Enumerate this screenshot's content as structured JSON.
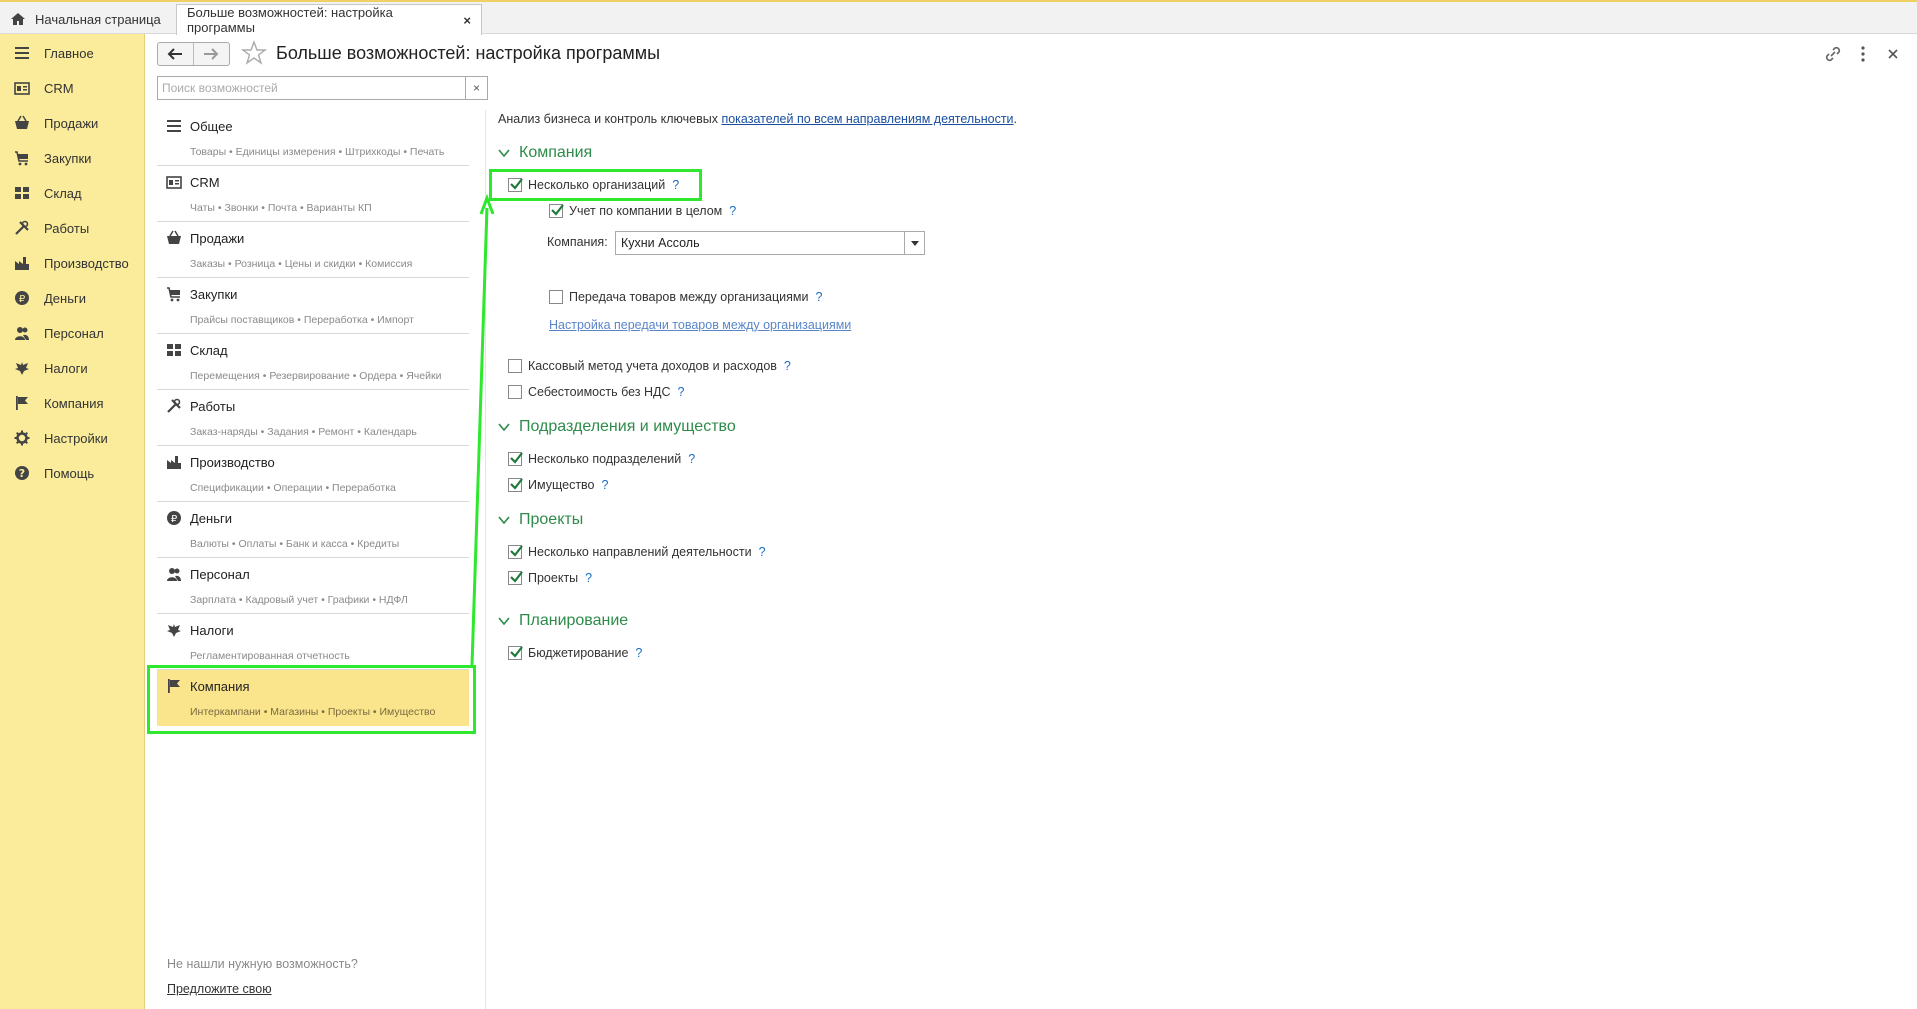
{
  "tabs": {
    "home": "Начальная страница",
    "active": "Больше возможностей: настройка программы",
    "close": "×"
  },
  "sections": [
    {
      "label": "Главное",
      "icon": "menu-icon"
    },
    {
      "label": "CRM",
      "icon": "crm-icon"
    },
    {
      "label": "Продажи",
      "icon": "basket-icon"
    },
    {
      "label": "Закупки",
      "icon": "cart-icon"
    },
    {
      "label": "Склад",
      "icon": "warehouse-icon"
    },
    {
      "label": "Работы",
      "icon": "tools-icon"
    },
    {
      "label": "Производство",
      "icon": "factory-icon"
    },
    {
      "label": "Деньги",
      "icon": "ruble-icon"
    },
    {
      "label": "Персонал",
      "icon": "people-icon"
    },
    {
      "label": "Налоги",
      "icon": "eagle-icon"
    },
    {
      "label": "Компания",
      "icon": "flag-icon"
    },
    {
      "label": "Настройки",
      "icon": "gear-icon"
    },
    {
      "label": "Помощь",
      "icon": "help-icon"
    }
  ],
  "header": {
    "title": "Больше возможностей: настройка программы"
  },
  "search": {
    "placeholder": "Поиск возможностей",
    "value": "",
    "clear": "×"
  },
  "features": [
    {
      "title": "Общее",
      "sub": "Товары • Единицы измерения • Штрихкоды • Печать",
      "icon": "menu-icon"
    },
    {
      "title": "CRM",
      "sub": "Чаты • Звонки • Почта • Варианты КП",
      "icon": "crm-icon"
    },
    {
      "title": "Продажи",
      "sub": "Заказы • Розница • Цены и скидки • Комиссия",
      "icon": "basket-icon"
    },
    {
      "title": "Закупки",
      "sub": "Прайсы поставщиков • Переработка • Импорт",
      "icon": "cart-icon"
    },
    {
      "title": "Склад",
      "sub": "Перемещения • Резервирование • Ордера • Ячейки",
      "icon": "warehouse-icon"
    },
    {
      "title": "Работы",
      "sub": "Заказ-наряды • Задания • Ремонт • Календарь",
      "icon": "tools-icon"
    },
    {
      "title": "Производство",
      "sub": "Спецификации • Операции • Переработка",
      "icon": "factory-icon"
    },
    {
      "title": "Деньги",
      "sub": "Валюты • Оплаты • Банк и касса • Кредиты",
      "icon": "ruble-icon"
    },
    {
      "title": "Персонал",
      "sub": "Зарплата • Кадровый учет • Графики • НДФЛ",
      "icon": "people-icon"
    },
    {
      "title": "Налоги",
      "sub": "Регламентированная отчетность",
      "icon": "eagle-icon"
    },
    {
      "title": "Компания",
      "sub": "Интеркампани • Магазины • Проекты • Имущество",
      "icon": "flag-icon",
      "selected": true
    }
  ],
  "footer": {
    "not_found": "Не нашли нужную возможность?",
    "suggest": "Предложите свою"
  },
  "content": {
    "intro_text": "Анализ бизнеса и контроль ключевых ",
    "intro_link": "показателей по всем направлениям деятельности",
    "intro_end": ".",
    "help": "?",
    "groups": {
      "company": "Компания",
      "divisions": "Подразделения и имущество",
      "projects": "Проекты",
      "planning": "Планирование"
    },
    "options": {
      "multi_org": {
        "label": "Несколько организаций",
        "checked": true
      },
      "company_whole": {
        "label": "Учет по компании в целом",
        "checked": true
      },
      "company_label": "Компания:",
      "company_value": "Кухни Ассоль",
      "transfer": {
        "label": "Передача товаров между организациями",
        "checked": false
      },
      "transfer_link": "Настройка передачи товаров между организациями",
      "cash_method": {
        "label": "Кассовый метод учета доходов и расходов",
        "checked": false
      },
      "cost_no_vat": {
        "label": "Себестоимость без НДС",
        "checked": false
      },
      "multi_div": {
        "label": "Несколько подразделений",
        "checked": true
      },
      "property": {
        "label": "Имущество",
        "checked": true
      },
      "multi_dir": {
        "label": "Несколько направлений деятельности",
        "checked": true
      },
      "projects": {
        "label": "Проекты",
        "checked": true
      },
      "budgeting": {
        "label": "Бюджетирование",
        "checked": true
      }
    }
  },
  "colors": {
    "section_bg": "#fbec9c",
    "selected_bg": "#fbe58c",
    "group_green": "#2e8b4a",
    "highlight": "#2ee82e",
    "link": "#1a4fa0"
  }
}
